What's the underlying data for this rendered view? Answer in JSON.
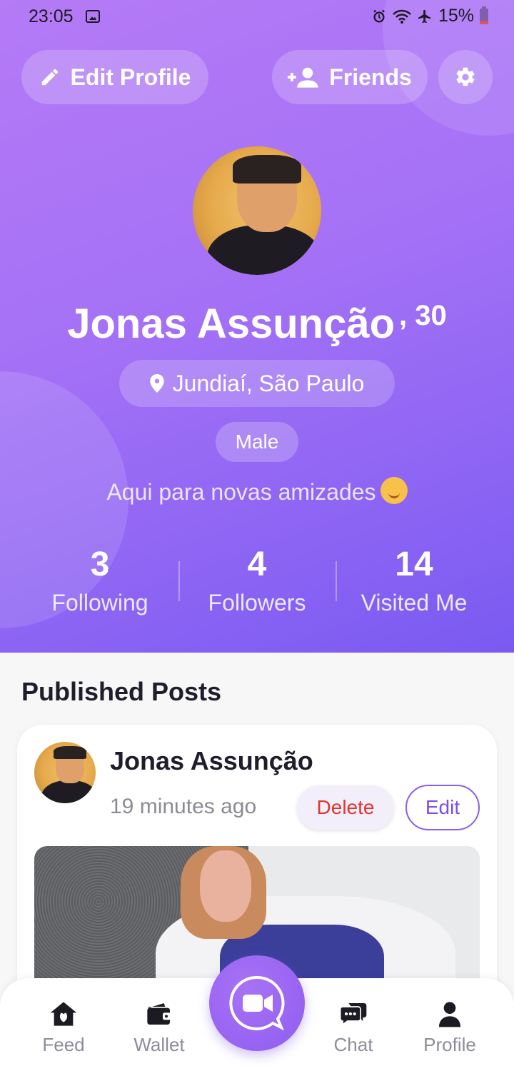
{
  "status_bar": {
    "time": "23:05",
    "battery": "15%"
  },
  "header": {
    "edit_profile_label": "Edit Profile",
    "friends_label": "Friends"
  },
  "profile": {
    "name": "Jonas Assunção",
    "age": ", 30",
    "location": "Jundiaí, São Paulo",
    "gender": "Male",
    "bio": "Aqui para novas amizades"
  },
  "stats": [
    {
      "value": "3",
      "label": "Following"
    },
    {
      "value": "4",
      "label": "Followers"
    },
    {
      "value": "14",
      "label": "Visited Me"
    }
  ],
  "posts_section": {
    "title": "Published Posts",
    "post": {
      "author": "Jonas Assunção",
      "time": "19 minutes ago",
      "delete_label": "Delete",
      "edit_label": "Edit"
    }
  },
  "nav": {
    "feed": "Feed",
    "wallet": "Wallet",
    "chat": "Chat",
    "profile": "Profile"
  },
  "colors": {
    "accent": "#8a5cf0",
    "gradient_start": "#b57af6",
    "gradient_end": "#7a5af2",
    "delete": "#e0352e"
  },
  "icons": [
    "pencil-icon",
    "add-person-icon",
    "gear-icon",
    "location-pin-icon",
    "smile-emoji",
    "home-leaf-icon",
    "wallet-icon",
    "video-camera-icon",
    "chat-bubbles-icon",
    "person-icon"
  ]
}
